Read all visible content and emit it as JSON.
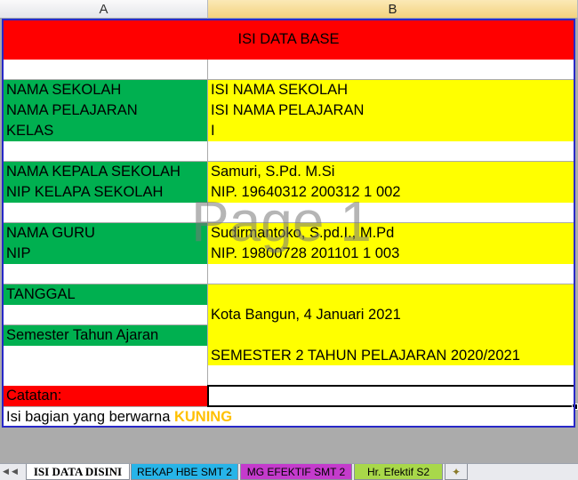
{
  "columns": [
    "A",
    "B"
  ],
  "title": "ISI DATA BASE",
  "rows": {
    "r1_a": "NAMA SEKOLAH",
    "r1_b": "ISI NAMA SEKOLAH",
    "r2_a": "NAMA PELAJARAN",
    "r2_b": "ISI NAMA PELAJARAN",
    "r3_a": "KELAS",
    "r3_b": "I",
    "r4_a": "NAMA KEPALA SEKOLAH",
    "r4_b": "Samuri, S.Pd. M.Si",
    "r5_a": "NIP KELAPA SEKOLAH",
    "r5_b": "NIP. 19640312 200312 1 002",
    "r6_a": "NAMA GURU",
    "r6_b": "Sudirmantoko, S.pd.I., M.Pd",
    "r7_a": "NIP",
    "r7_b": "NIP. 19800728 201101 1 003",
    "r8_a": "TANGGAL",
    "r9_b": "Kota Bangun, 4 Januari 2021",
    "r10_a": "Semester Tahun Ajaran",
    "r11_b": "SEMESTER  2  TAHUN PELAJARAN 2020/2021"
  },
  "notes": {
    "label": "Catatan:",
    "text": "Isi bagian yang berwarna ",
    "highlight": "KUNING",
    "highlight_color": "#ffc000"
  },
  "watermark": "Page 1",
  "sheet_tabs": [
    "ISI DATA DISINI",
    "REKAP HBE SMT 2",
    "MG EFEKTIF SMT 2",
    "Hr. Efektif S2"
  ],
  "colors": {
    "red": "#ff0000",
    "green": "#00b050",
    "yellow": "#ffff00"
  }
}
